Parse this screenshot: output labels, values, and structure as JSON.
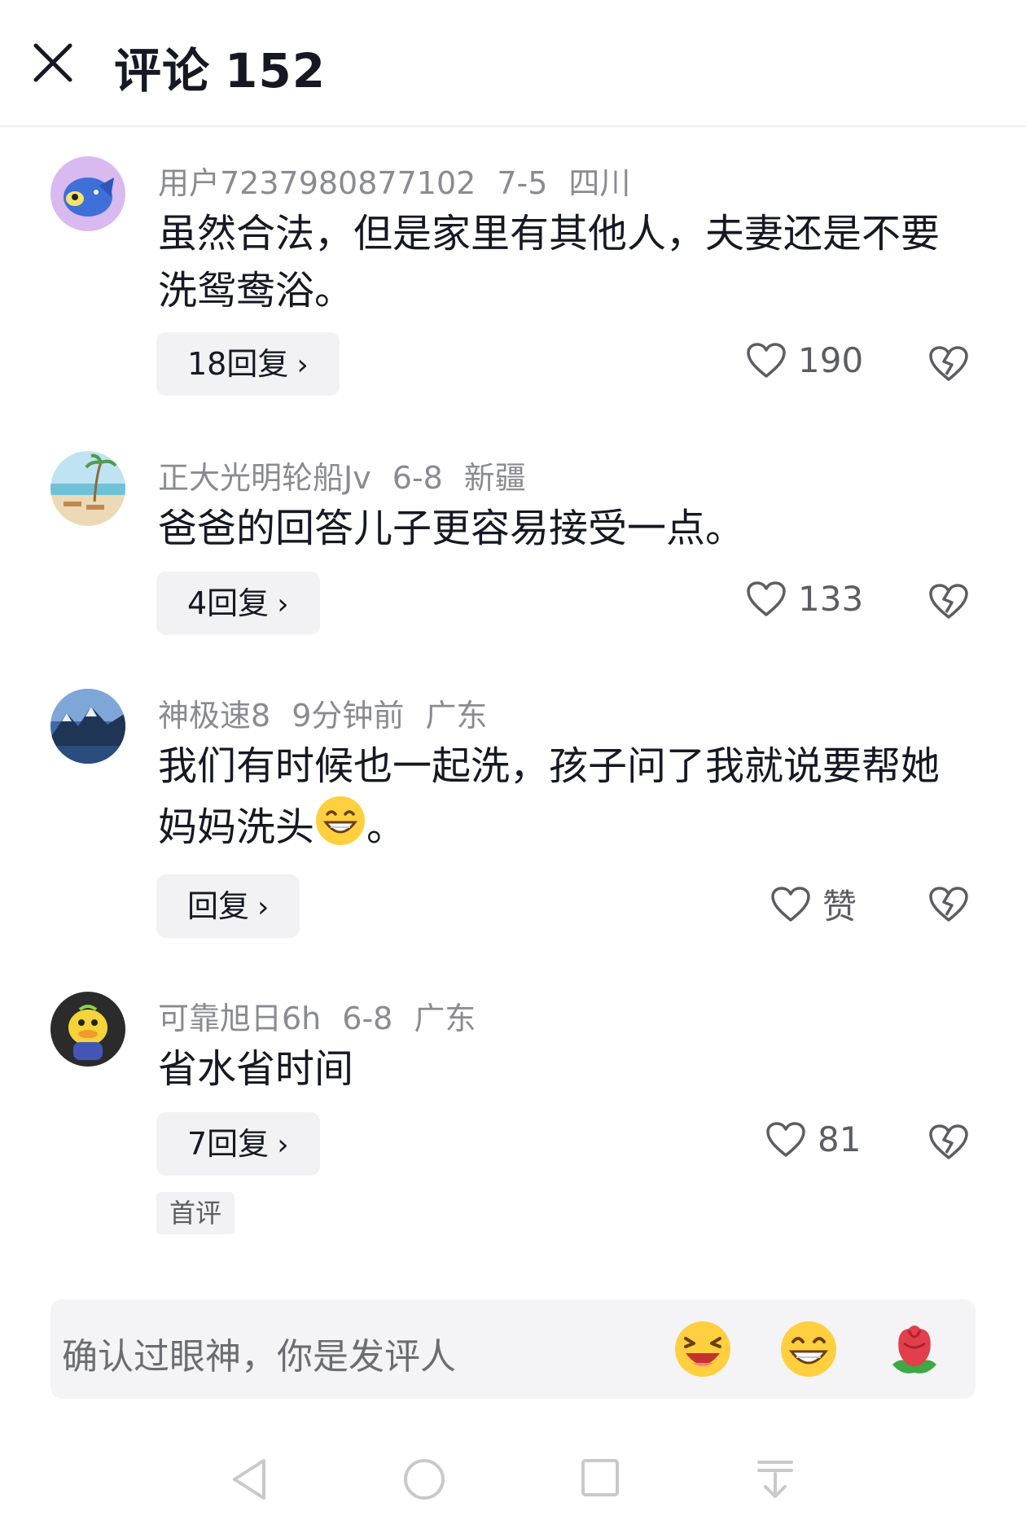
{
  "header": {
    "title": "评论",
    "count": "152"
  },
  "comments": [
    {
      "user": "用户7237980877102",
      "date": "7-5",
      "location": "四川",
      "text": "虽然合法，但是家里有其他人，夫妻还是不要洗鸳鸯浴。",
      "reply_label": "18回复",
      "likes": "190"
    },
    {
      "user": "正大光明轮船Jv",
      "date": "6-8",
      "location": "新疆",
      "text": "爸爸的回答儿子更容易接受一点。",
      "reply_label": "4回复",
      "likes": "133"
    },
    {
      "user": "神极速8",
      "date": "9分钟前",
      "location": "广东",
      "text_before_emoji": "我们有时候也一起洗，孩子问了我就说要帮她妈妈洗头",
      "text_after_emoji": "。",
      "reply_label": "回复",
      "likes": "赞"
    },
    {
      "user": "可靠旭日6h",
      "date": "6-8",
      "location": "广东",
      "text": "省水省时间",
      "reply_label": "7回复",
      "likes": "81",
      "tag": "首评"
    }
  ],
  "input": {
    "placeholder": "确认过眼神，你是发评人"
  },
  "input_emojis": [
    "laughing-emoji",
    "grinning-emoji",
    "rose-emoji"
  ],
  "colors": {
    "text": "#161823",
    "secondary": "#8a8b91",
    "button_bg": "#f2f2f4"
  }
}
